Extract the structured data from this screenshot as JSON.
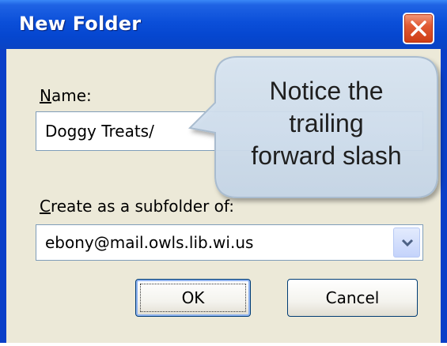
{
  "window": {
    "title": "New Folder"
  },
  "name_field": {
    "label_prefix": "",
    "label_accel": "N",
    "label_rest": "ame:",
    "value": "Doggy Treats/"
  },
  "subfolder": {
    "label_accel": "C",
    "label_rest": "reate as a subfolder of:",
    "selected": "ebony@mail.owls.lib.wi.us"
  },
  "buttons": {
    "ok": "OK",
    "cancel": "Cancel"
  },
  "callout": {
    "line1": "Notice the",
    "line2": "trailing",
    "line3": "forward slash"
  },
  "icons": {
    "close": "close-icon",
    "dropdown": "chevron-down-icon"
  },
  "colors": {
    "titlebar": "#0b4fd9",
    "client": "#ece9d8",
    "close": "#e15a34"
  }
}
